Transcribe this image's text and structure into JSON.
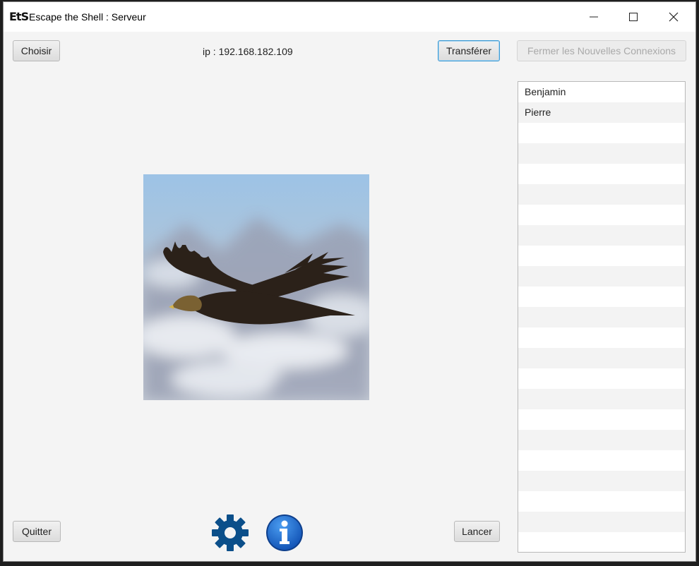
{
  "window": {
    "logo_text": "EtS",
    "title": "Escape the Shell : Serveur"
  },
  "toolbar": {
    "choose_label": "Choisir",
    "ip_text": "ip : 192.168.182.109",
    "transfer_label": "Transférer",
    "close_connections_label": "Fermer les Nouvelles Connexions"
  },
  "players": {
    "items": [
      "Benjamin",
      "Pierre",
      "",
      "",
      "",
      "",
      "",
      "",
      "",
      "",
      "",
      "",
      "",
      "",
      "",
      "",
      "",
      "",
      "",
      "",
      "",
      "",
      "",
      ""
    ]
  },
  "footer": {
    "quit_label": "Quitter",
    "launch_label": "Lancer"
  },
  "icons": {
    "settings": "gear-icon",
    "info": "info-icon",
    "minimize": "minimize-icon",
    "maximize": "maximize-icon",
    "close": "close-icon",
    "preview": "eagle-image"
  },
  "colors": {
    "gear": "#0b4f8a",
    "info": "#1f6fd1",
    "focus": "#3c9bd4"
  }
}
